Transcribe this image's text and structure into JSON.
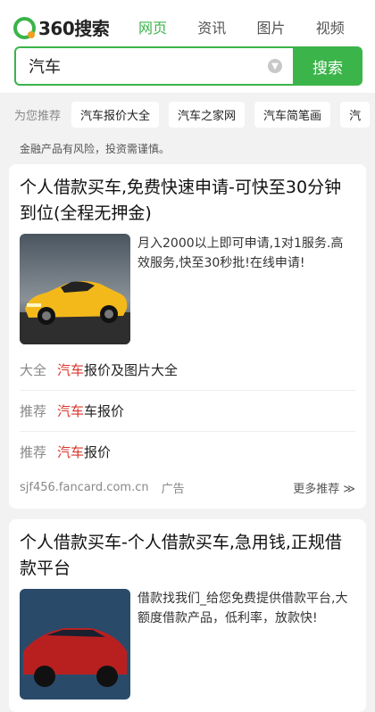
{
  "header": {
    "logo_text": "360搜索",
    "nav": [
      "网页",
      "资讯",
      "图片",
      "视频"
    ],
    "search_value": "汽车",
    "search_button": "搜索"
  },
  "recommend": {
    "label": "为您推荐",
    "chips": [
      "汽车报价大全",
      "汽车之家网",
      "汽车简笔画",
      "汽"
    ]
  },
  "risk_notice": "金融产品有风险，投资需谨慎。",
  "cards": [
    {
      "title": "个人借款买车,免费快速申请-可快至30分钟到位(全程无押金)",
      "desc": "月入2000以上即可申请,1对1服务.高效服务,快至30秒批!在线申请!",
      "sitelinks": [
        {
          "tag": "大全",
          "kw": "汽车",
          "rest": "报价及图片大全"
        },
        {
          "tag": "推荐",
          "kw": "汽车",
          "rest": "车报价"
        },
        {
          "tag": "推荐",
          "kw": "汽车",
          "rest": "报价"
        }
      ],
      "url": "sjf456.fancard.com.cn",
      "ad_label": "广告",
      "more": "更多推荐"
    },
    {
      "title": "个人借款买车-个人借款买车,急用钱,正规借款平台",
      "desc": "借款找我们_给您免费提供借款平台,大额度借款产品，低利率，放款快!"
    }
  ]
}
